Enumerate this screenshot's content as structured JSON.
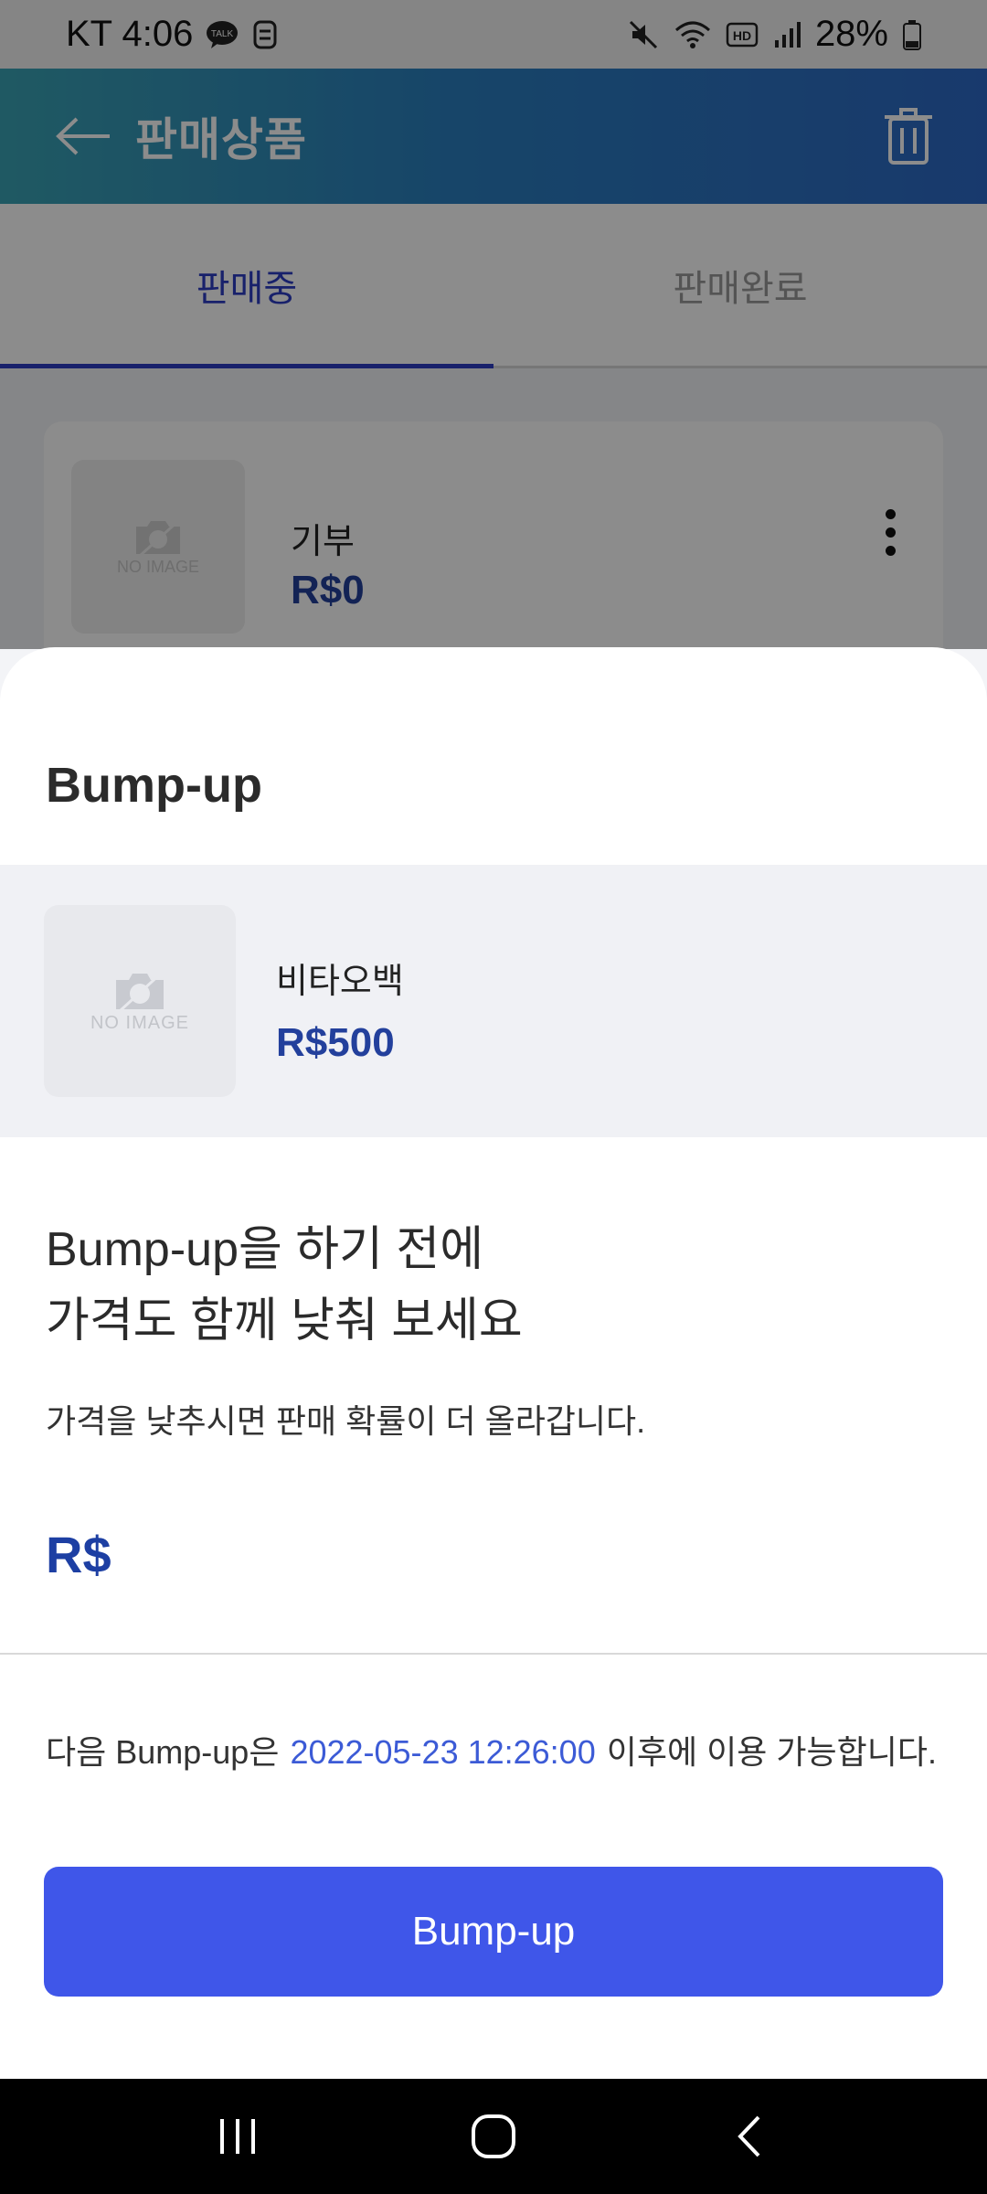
{
  "status_bar": {
    "carrier_time": "KT 4:06",
    "battery": "28%",
    "icons": [
      "kakaotalk-icon",
      "notification-icon",
      "mute-icon",
      "wifi-icon",
      "hd-icon",
      "signal-icon",
      "battery-icon"
    ]
  },
  "header": {
    "title": "판매상품",
    "back_icon": "arrow-left-icon",
    "delete_icon": "trash-icon"
  },
  "tabs": [
    {
      "label": "판매중",
      "active": true
    },
    {
      "label": "판매완료",
      "active": false
    }
  ],
  "list_item": {
    "name": "기부",
    "price": "R$0",
    "no_image_label": "NO IMAGE"
  },
  "sheet": {
    "title": "Bump-up",
    "product": {
      "name": "비타오백",
      "price": "R$500",
      "no_image_label": "NO IMAGE"
    },
    "headline_line1": "Bump-up을 하기 전에",
    "headline_line2": "가격도 함께 낮춰 보세요",
    "description": "가격을 낮추시면 판매 확률이 더 올라갑니다.",
    "price_prefix": "R$",
    "notice_prefix": "다음 Bump-up은",
    "notice_date": "2022-05-23 12:26:00",
    "notice_suffix": "이후에 이용 가능합니다.",
    "button_label": "Bump-up"
  },
  "colors": {
    "primary": "#3f56e9",
    "price": "#23409c",
    "tab_active": "#2d3cc4",
    "date": "#3c5bd6"
  }
}
